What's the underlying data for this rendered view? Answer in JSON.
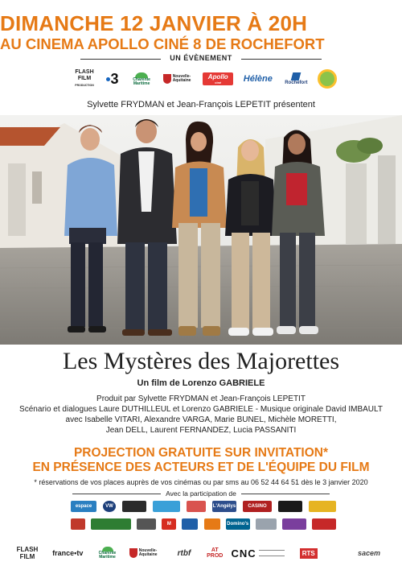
{
  "header": {
    "date": "DIMANCHE 12 JANVIER À 20H",
    "venue": "AU CINEMA APOLLO CINÉ 8 DE ROCHEFORT",
    "event": "UN ÉVÈNEMENT"
  },
  "top_logos": [
    {
      "name": "flash-film-logo",
      "text": "FLASH FILM",
      "sub": "PRODUCTION"
    },
    {
      "name": "france3-logo",
      "text": "3"
    },
    {
      "name": "charente-maritime-logo",
      "text": "Charente Maritime"
    },
    {
      "name": "nouvelle-aquitaine-logo",
      "text": "Nouvelle-Aquitaine"
    },
    {
      "name": "apollo-cine-logo",
      "text": "Apollo",
      "sub": "ciné"
    },
    {
      "name": "helene-fm-logo",
      "text": "Hélène"
    },
    {
      "name": "rochefort-logo",
      "text": "Rochefort"
    },
    {
      "name": "circle-logo",
      "text": ""
    }
  ],
  "presenters": "Sylvette FRYDMAN et Jean-François LEPETIT présentent",
  "film": {
    "title": "Les Mystères des Majorettes",
    "director_line": "Un film de Lorenzo GABRIELE",
    "credits": [
      "Produit par Sylvette FRYDMAN et Jean-François LEPETIT",
      "Scénario et dialogues Laure DUTHILLEUL et Lorenzo GABRIELE - Musique originale David IMBAULT",
      "avec Isabelle VITARI, Alexandre VARGA, Marie BUNEL, Michèle MORETTI,",
      "Jean DELL, Laurent FERNANDEZ, Lucia PASSANITI"
    ]
  },
  "projection": {
    "line1": "PROJECTION GRATUITE SUR INVITATION*",
    "line2": "EN PRÉSENCE DES ACTEURS ET DE L'ÉQUIPE DU FILM"
  },
  "reservation": "* réservations de vos places auprès de vos cinémas ou par sms au 06 52 44 64 51 dès le 3 janvier 2020",
  "participation": "Avec la participation de",
  "sponsor_rows": [
    [
      {
        "label": "espace",
        "color": "#2a7fc1"
      },
      {
        "label": "VW",
        "color": "#1d3f7a"
      },
      {
        "label": "",
        "color": "#2b2b2b"
      },
      {
        "label": "",
        "color": "#3aa0d8"
      },
      {
        "label": "",
        "color": "#d9534f"
      },
      {
        "label": "L'Angélys",
        "color": "#2d4e8c"
      },
      {
        "label": "CASINO",
        "color": "#b02020"
      },
      {
        "label": "",
        "color": "#1a1a1a"
      },
      {
        "label": "",
        "color": "#e6b422"
      }
    ],
    [
      {
        "label": "",
        "color": "#c0392b"
      },
      {
        "label": "",
        "color": "#2e7d32"
      },
      {
        "label": "",
        "color": "#555555"
      },
      {
        "label": "M",
        "color": "#d62d20"
      },
      {
        "label": "",
        "color": "#1f5fa8"
      },
      {
        "label": "",
        "color": "#e67a16"
      },
      {
        "label": "Domino's",
        "color": "#006491"
      },
      {
        "label": "",
        "color": "#9aa3ad"
      },
      {
        "label": "",
        "color": "#7a3e9d"
      },
      {
        "label": "",
        "color": "#c62828"
      }
    ]
  ],
  "bottom_logos": [
    {
      "name": "flash-film-logo-bottom",
      "text": "FLASH FILM"
    },
    {
      "name": "france-tv-logo",
      "text": "france•tv"
    },
    {
      "name": "charente-maritime-logo-bottom",
      "text": "Charente Maritime"
    },
    {
      "name": "nouvelle-aquitaine-logo-bottom",
      "text": "Nouvelle-Aquitaine"
    },
    {
      "name": "rtbf-logo",
      "text": "rtbf"
    },
    {
      "name": "at-prod-logo",
      "text": "AT PROD"
    },
    {
      "name": "cnc-logo",
      "text": "CNC"
    },
    {
      "name": "rts-logo",
      "text": "RTS"
    },
    {
      "name": "sacem-logo",
      "text": "sacem"
    }
  ],
  "colors": {
    "accent": "#e67a16",
    "text": "#222222"
  }
}
